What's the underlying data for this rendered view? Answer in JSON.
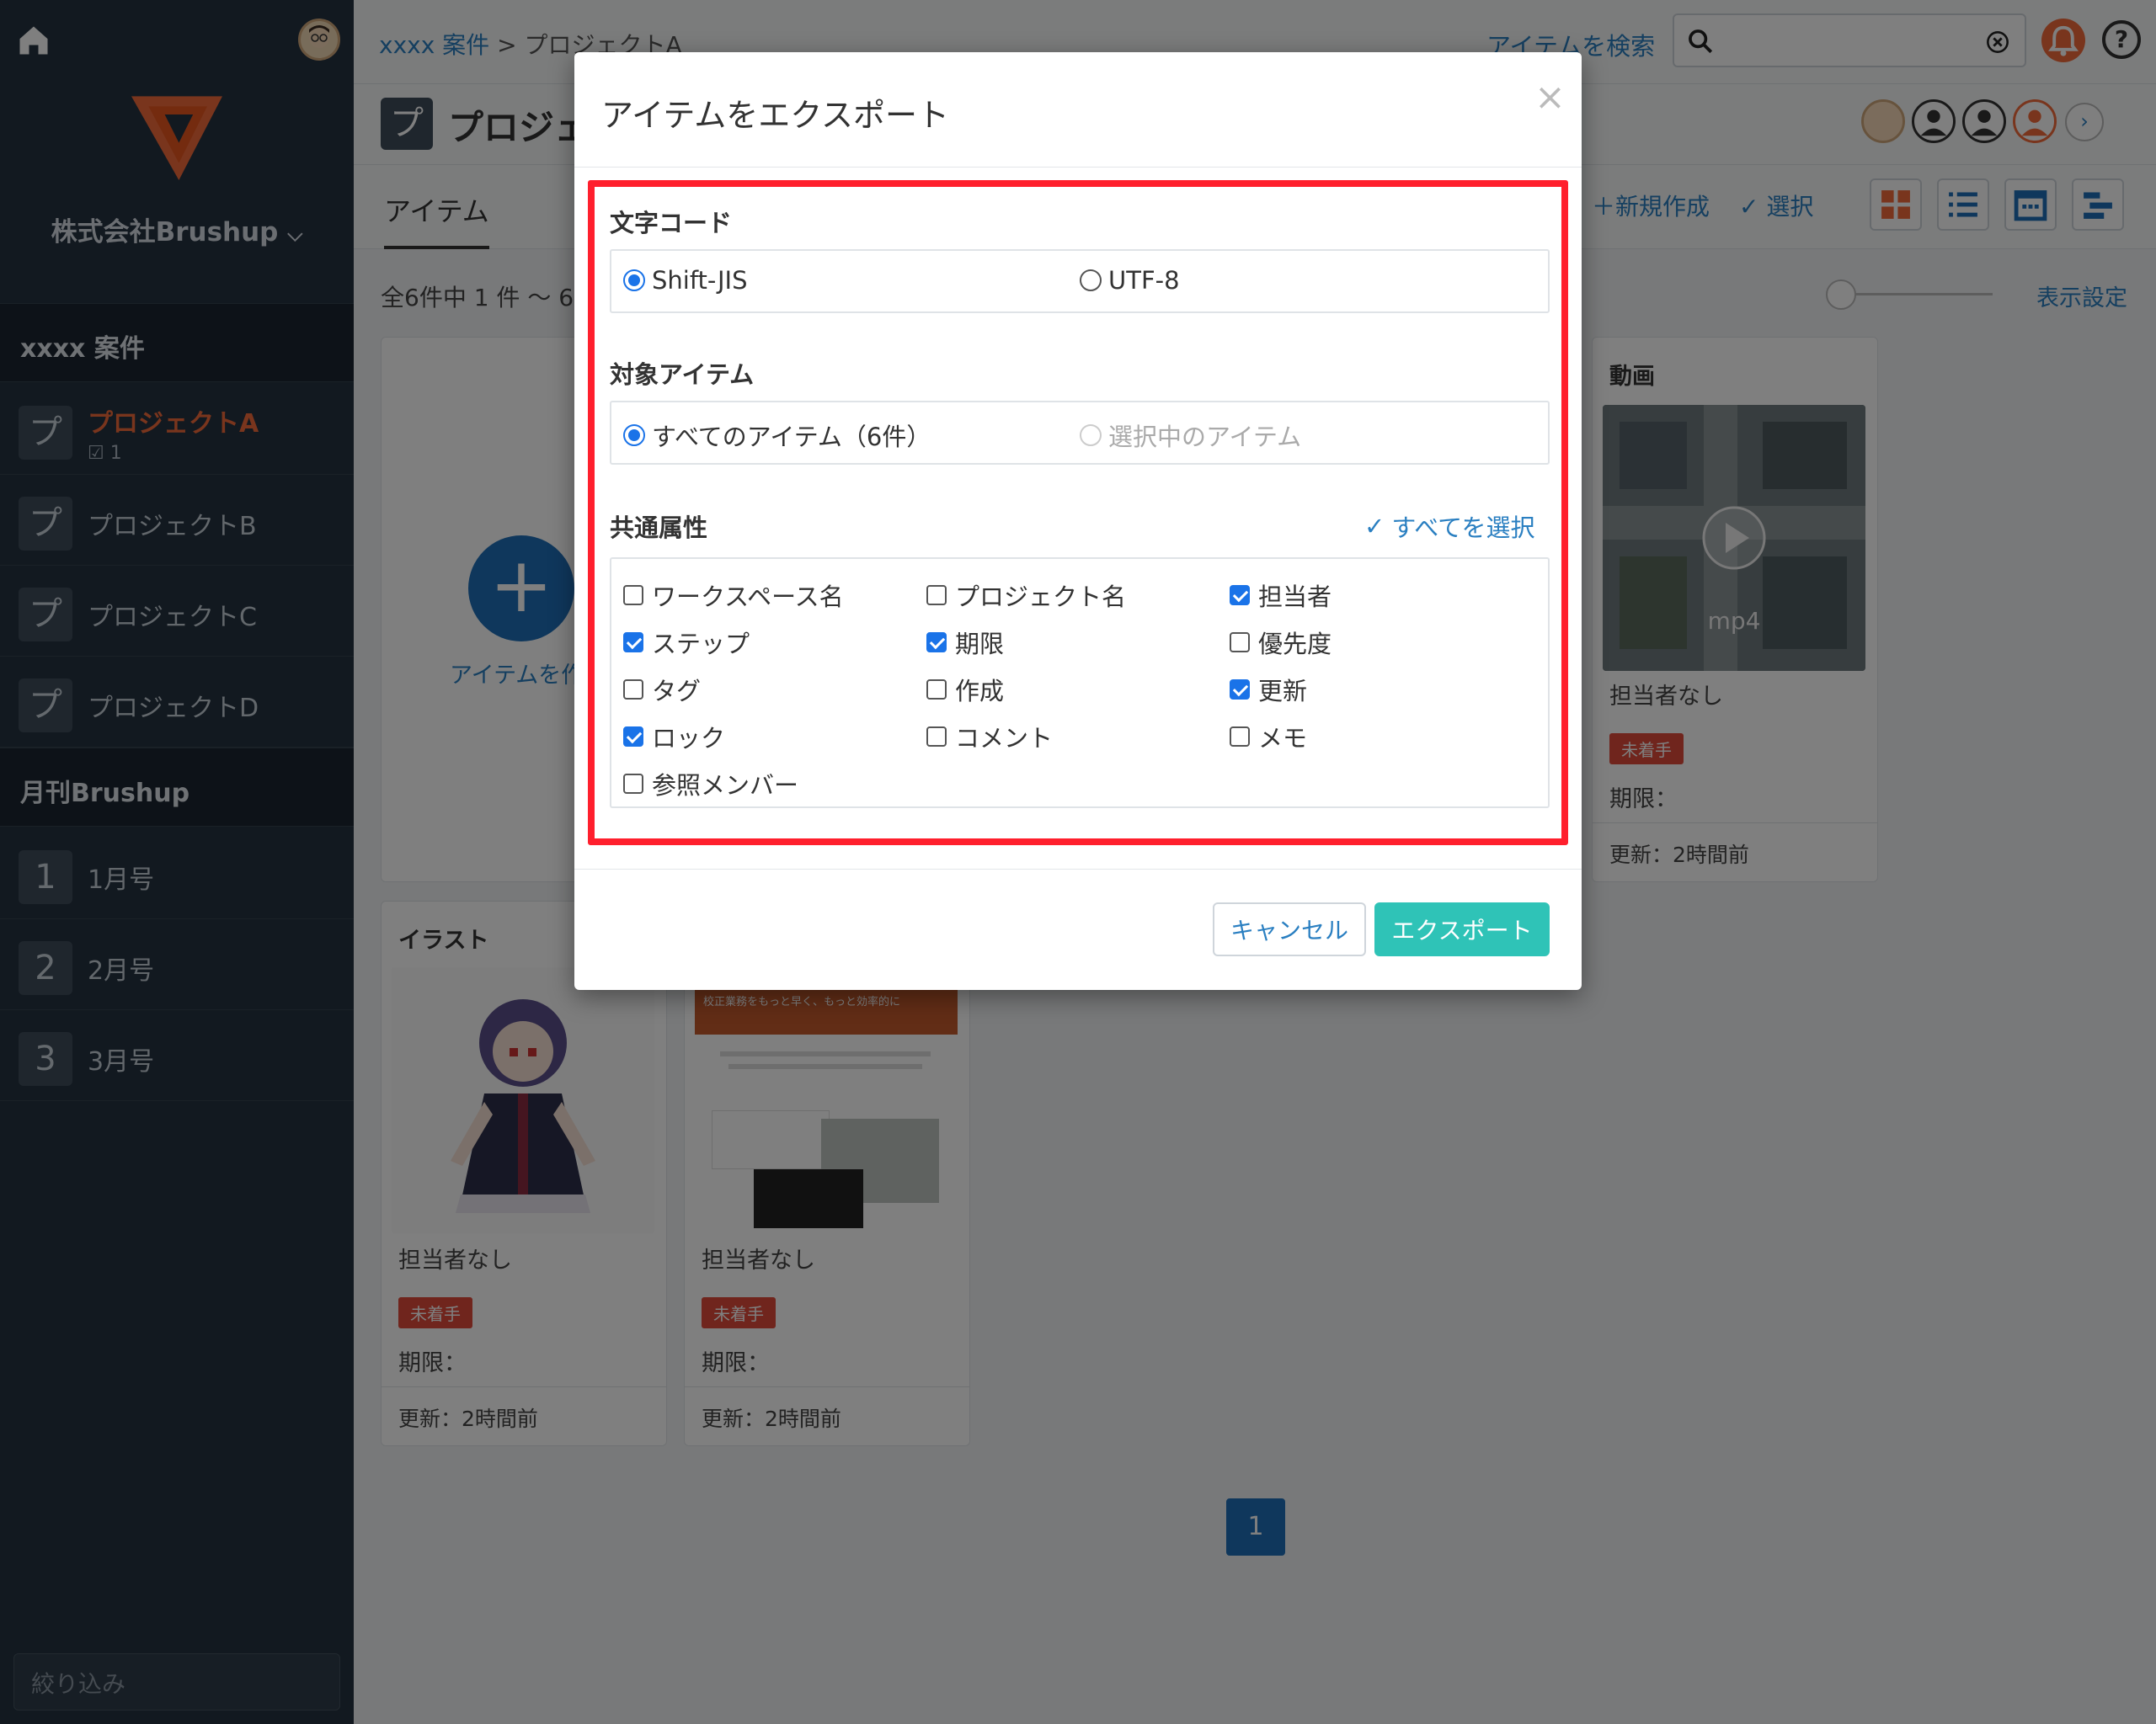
{
  "sidebar": {
    "company": "株式会社Brushup",
    "groups": [
      {
        "label": "xxxx 案件"
      },
      {
        "label": "月刊Brushup"
      }
    ],
    "projects": [
      {
        "icon": "プ",
        "label": "プロジェクトA",
        "count": "1"
      },
      {
        "icon": "プ",
        "label": "プロジェクトB"
      },
      {
        "icon": "プ",
        "label": "プロジェクトC"
      },
      {
        "icon": "プ",
        "label": "プロジェクトD"
      }
    ],
    "issues": [
      {
        "icon": "1",
        "label": "1月号"
      },
      {
        "icon": "2",
        "label": "2月号"
      },
      {
        "icon": "3",
        "label": "3月号"
      }
    ],
    "filter_placeholder": "絞り込み"
  },
  "topbar": {
    "breadcrumb_parent": "xxxx 案件",
    "breadcrumb_sep": " > ",
    "breadcrumb_current": "プロジェクトA",
    "search_link": "アイテムを検索",
    "help": "?"
  },
  "project": {
    "icon": "プ",
    "title": "プロジェ"
  },
  "toolbar": {
    "tab_items": "アイテム",
    "new": "新規作成",
    "select": "選択",
    "count": "全6件中 1 件 〜 6",
    "display_settings": "表示設定"
  },
  "cards": {
    "add_label": "アイテムを作",
    "video": {
      "title": "動画",
      "format": "mp4",
      "assignee": "担当者なし",
      "status": "未着手",
      "due": "期限：",
      "updated": "更新：2時間前"
    },
    "illust": {
      "title": "イラスト",
      "assignee": "担当者なし",
      "status": "未着手",
      "due": "期限：",
      "updated": "更新：2時間前"
    },
    "web": {
      "banner": "校正業務をもっと早く、もっと効率的に",
      "assignee": "担当者なし",
      "status": "未着手",
      "due": "期限：",
      "updated": "更新：2時間前"
    }
  },
  "pager": {
    "page": "1"
  },
  "modal": {
    "title": "アイテムをエクスポート",
    "close": "×",
    "charset": {
      "label": "文字コード",
      "options": [
        {
          "label": "Shift-JIS",
          "selected": true
        },
        {
          "label": "UTF-8",
          "selected": false
        }
      ]
    },
    "target": {
      "label": "対象アイテム",
      "options": [
        {
          "label": "すべてのアイテム（6件）",
          "selected": true
        },
        {
          "label": "選択中のアイテム",
          "selected": false,
          "disabled": true
        }
      ]
    },
    "attributes": {
      "label": "共通属性",
      "select_all": "すべてを選択",
      "items": [
        {
          "label": "ワークスペース名",
          "checked": false
        },
        {
          "label": "プロジェクト名",
          "checked": false
        },
        {
          "label": "担当者",
          "checked": true
        },
        {
          "label": "ステップ",
          "checked": true
        },
        {
          "label": "期限",
          "checked": true
        },
        {
          "label": "優先度",
          "checked": false
        },
        {
          "label": "タグ",
          "checked": false
        },
        {
          "label": "作成",
          "checked": false
        },
        {
          "label": "更新",
          "checked": true
        },
        {
          "label": "ロック",
          "checked": true
        },
        {
          "label": "コメント",
          "checked": false
        },
        {
          "label": "メモ",
          "checked": false
        },
        {
          "label": "参照メンバー",
          "checked": false
        }
      ]
    },
    "cancel": "キャンセル",
    "export": "エクスポート"
  },
  "colors": {
    "sidebar_bg": "#253241",
    "accent_blue": "#2a7fc1",
    "highlight_red": "#ff1f2d",
    "export_button": "#2fc3b7",
    "status_badge": "#e04b3a"
  }
}
